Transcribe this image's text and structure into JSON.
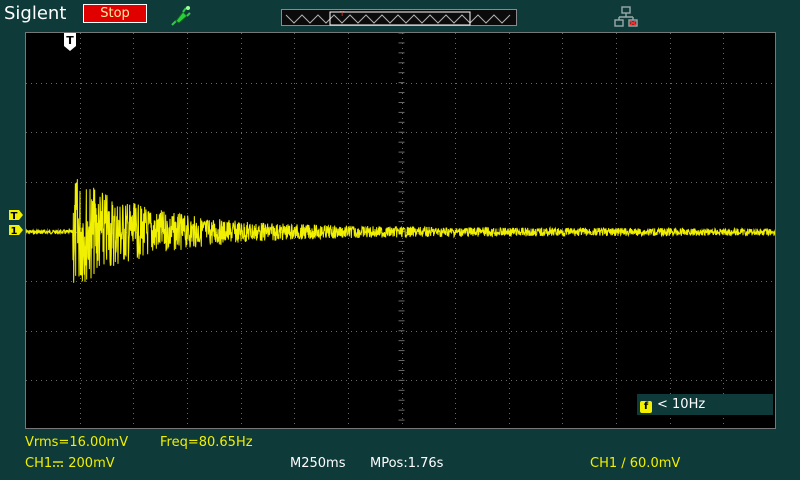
{
  "header": {
    "brand": "Siglent",
    "run_status": "Stop"
  },
  "colors": {
    "background": "#0f3a3a",
    "screen": "#000000",
    "trace": "#f0f000",
    "stop_button": "#e00000",
    "probe_icon": "#2ecc40",
    "grid": "#6a6a6a"
  },
  "icons": {
    "probe": "probe-icon",
    "network": "network-disconnected-icon",
    "trigger_position": "trigger-position-marker-icon",
    "trigger_level": "trigger-level-marker-icon",
    "channel_1": "channel-1-marker-icon"
  },
  "markers": {
    "trigger_position": "T",
    "trigger_level": "T",
    "channel_1": "1"
  },
  "trigger_info": {
    "badge": "f",
    "frequency": "< 10Hz"
  },
  "measurements": {
    "vrms": "Vrms=16.00mV",
    "freq": "Freq=80.65Hz"
  },
  "status_bar": {
    "ch1_label": "CH1",
    "ch1_scale": "200mV",
    "timebase": "M250ms",
    "mpos": "MPos:1.76s",
    "trigger": "CH1 ∕ 60.0mV"
  }
}
